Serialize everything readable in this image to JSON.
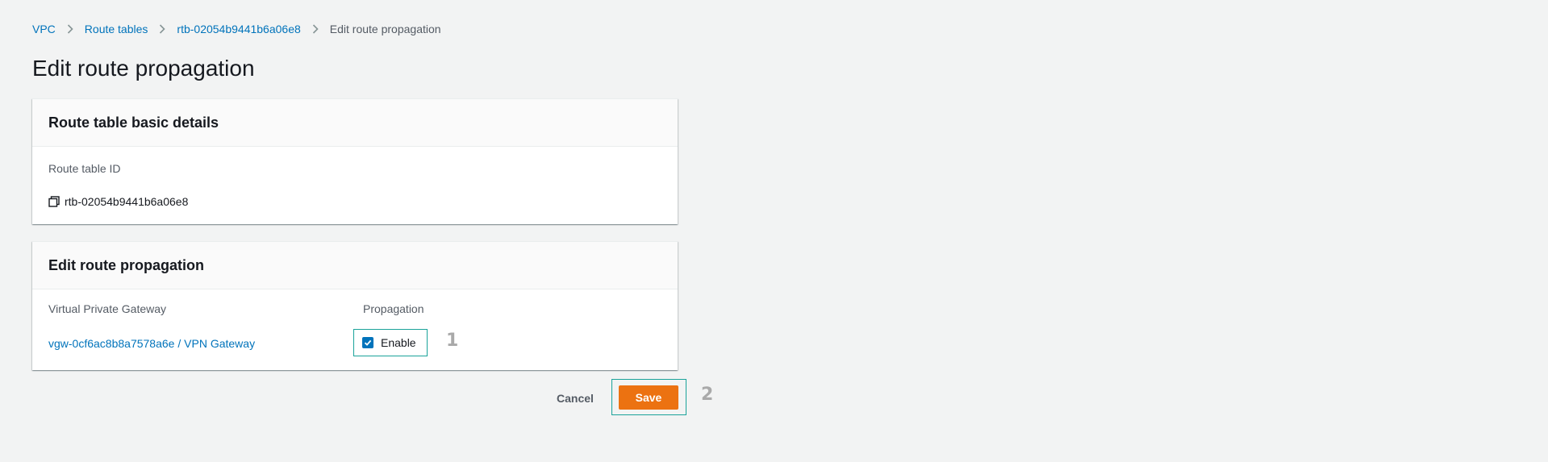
{
  "breadcrumb": {
    "items": [
      "VPC",
      "Route tables",
      "rtb-02054b9441b6a06e8"
    ],
    "current": "Edit route propagation"
  },
  "page_title": "Edit route propagation",
  "basic_details": {
    "title": "Route table basic details",
    "route_table_id_label": "Route table ID",
    "route_table_id": "rtb-02054b9441b6a06e8"
  },
  "propagation": {
    "title": "Edit route propagation",
    "col_gateway": "Virtual Private Gateway",
    "col_propagation": "Propagation",
    "row": {
      "gateway_id": "vgw-0cf6ac8b8a7578a6e",
      "separator": "/",
      "gateway_name": "VPN Gateway",
      "enable_label": "Enable",
      "enabled": true
    }
  },
  "actions": {
    "cancel_label": "Cancel",
    "save_label": "Save"
  },
  "annotations": [
    "1",
    "2"
  ],
  "colors": {
    "link": "#0073bb",
    "primary_button": "#ec7211",
    "highlight_frame": "#1aa39a",
    "background": "#f2f3f3"
  }
}
